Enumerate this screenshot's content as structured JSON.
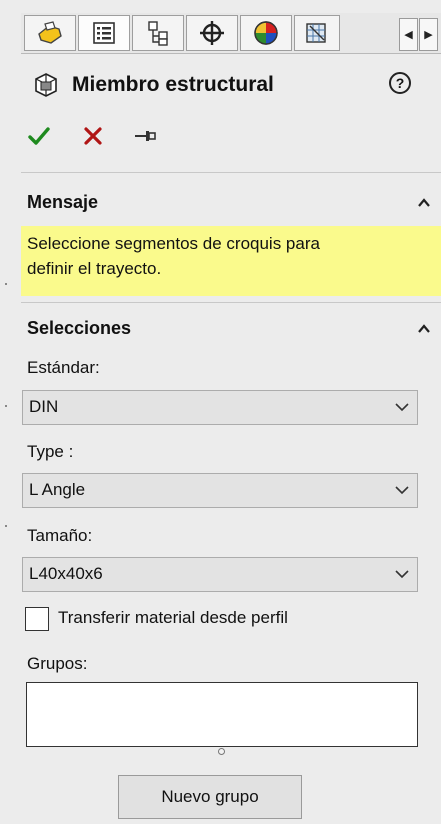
{
  "tabs": [
    {
      "icon": "feature-manager-icon"
    },
    {
      "icon": "property-manager-icon"
    },
    {
      "icon": "configuration-manager-icon"
    },
    {
      "icon": "dimxpert-icon"
    },
    {
      "icon": "display-manager-icon"
    },
    {
      "icon": "cam-icon"
    }
  ],
  "tab_scroll": {
    "left": "◀",
    "right": "▶"
  },
  "panel": {
    "title": "Miembro estructural",
    "help": "?"
  },
  "actions": {
    "ok": "✓",
    "cancel": "✕",
    "pin": "⊣"
  },
  "mensaje": {
    "header": "Mensaje",
    "text_line1": "Seleccione segmentos de croquis para",
    "text_line2": "definir el trayecto."
  },
  "selecciones": {
    "header": "Selecciones",
    "estandar_label": "Estándar:",
    "estandar_value": "DIN",
    "type_label": "Type :",
    "type_value": "L Angle",
    "tamano_label": "Tamaño:",
    "tamano_value": "L40x40x6",
    "transfer_label": "Transferir material desde perfil",
    "transfer_checked": false,
    "grupos_label": "Grupos:",
    "new_group_button": "Nuevo grupo"
  },
  "colors": {
    "message_bg": "#fafa8c",
    "ok": "#1e8a1e",
    "cancel": "#b01515"
  }
}
